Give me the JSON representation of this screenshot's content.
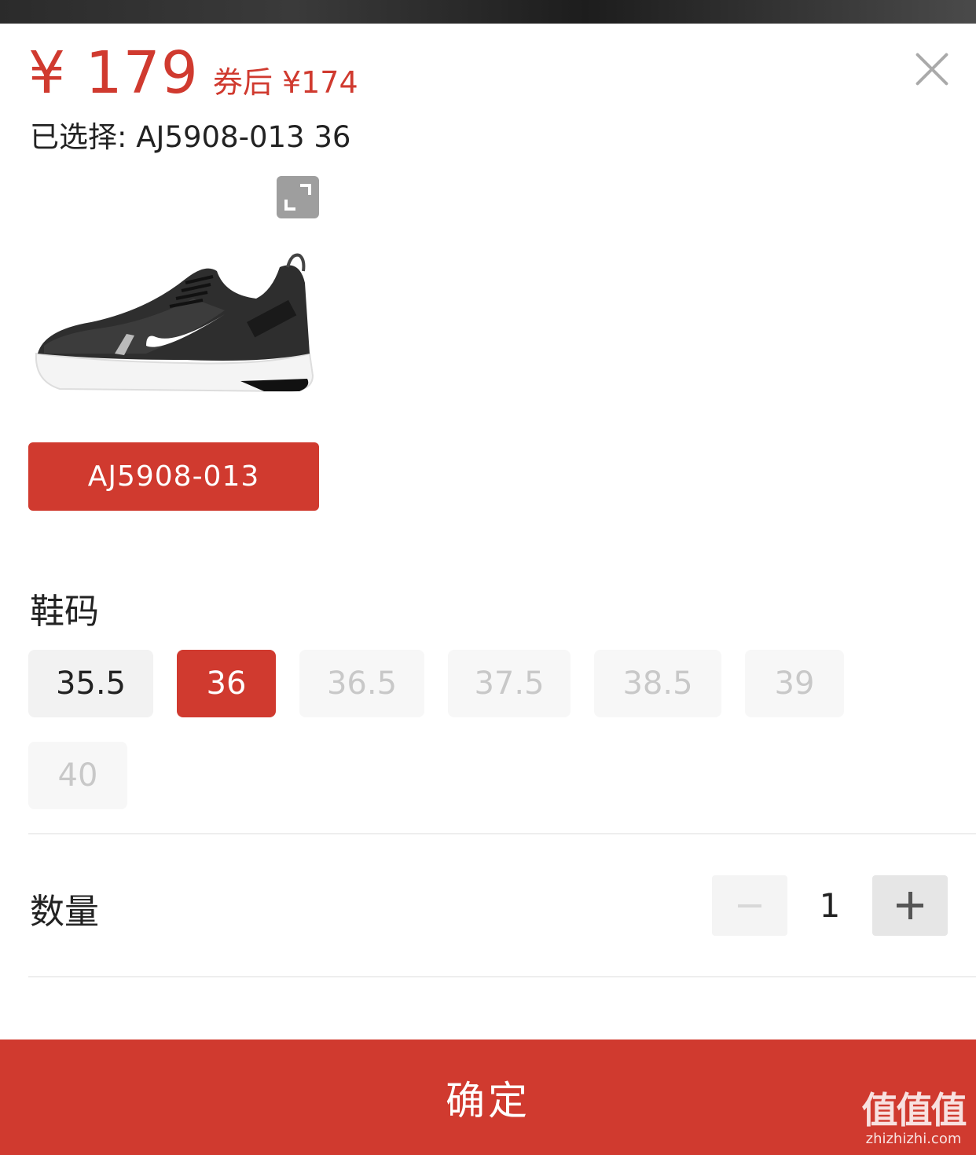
{
  "price": {
    "main": "¥ 179",
    "coupon": "券后 ¥174"
  },
  "selection": {
    "text": "已选择: AJ5908-013 36"
  },
  "variant": {
    "label": "AJ5908-013"
  },
  "sizes": {
    "title": "鞋码",
    "options": [
      "35.5",
      "36",
      "36.5",
      "37.5",
      "38.5",
      "39",
      "40"
    ]
  },
  "quantity": {
    "title": "数量",
    "value": "1"
  },
  "confirm": {
    "label": "确定"
  },
  "watermark": {
    "logo": "值值值",
    "url": "zhizhizhi.com"
  },
  "colors": {
    "accent": "#d03a2f"
  }
}
